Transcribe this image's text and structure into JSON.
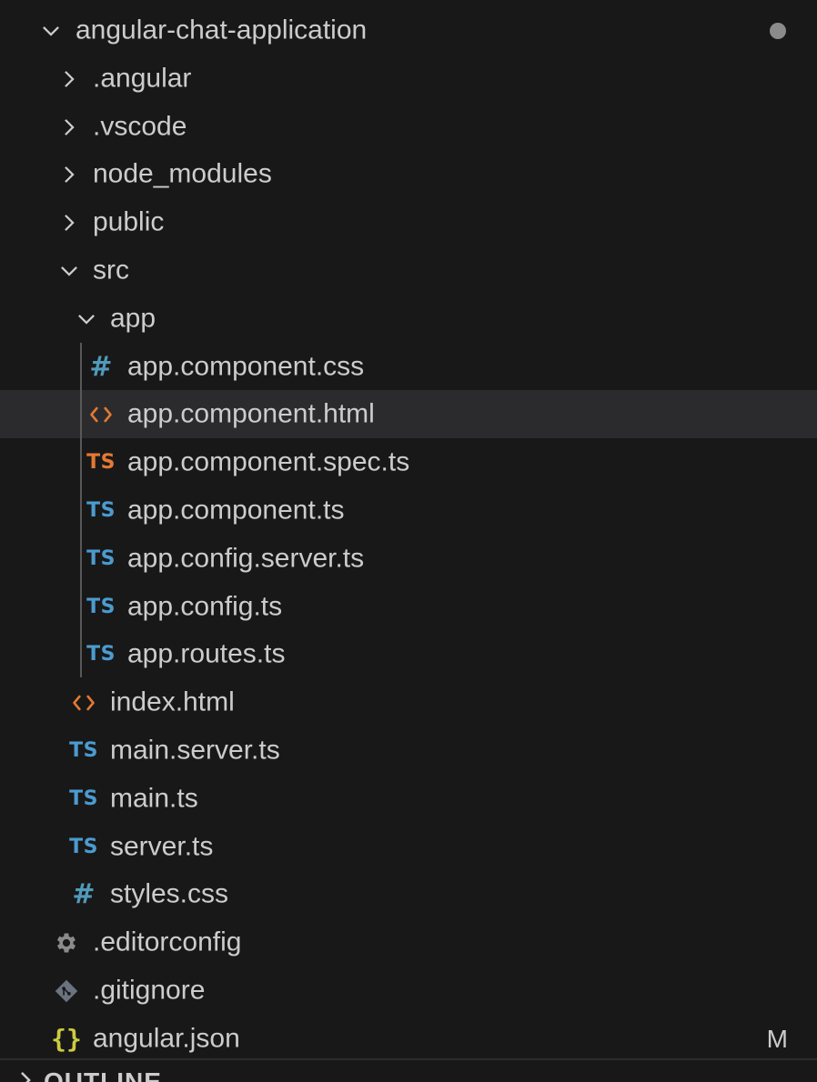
{
  "explorer": {
    "root": {
      "label": "angular-chat-application",
      "expanded": true,
      "status": "modified-dot"
    },
    "folders": [
      {
        "label": ".angular",
        "expanded": false
      },
      {
        "label": ".vscode",
        "expanded": false
      },
      {
        "label": "node_modules",
        "expanded": false
      },
      {
        "label": "public",
        "expanded": false
      }
    ],
    "src": {
      "label": "src",
      "expanded": true
    },
    "app": {
      "label": "app",
      "expanded": true
    },
    "app_files": [
      {
        "label": "app.component.css",
        "icon": "css-hash-icon",
        "icon_text": "#"
      },
      {
        "label": "app.component.html",
        "icon": "html-icon",
        "icon_text": "<>",
        "selected": true
      },
      {
        "label": "app.component.spec.ts",
        "icon": "ts-spec-icon",
        "icon_text": "TS"
      },
      {
        "label": "app.component.ts",
        "icon": "ts-icon",
        "icon_text": "TS"
      },
      {
        "label": "app.config.server.ts",
        "icon": "ts-icon",
        "icon_text": "TS"
      },
      {
        "label": "app.config.ts",
        "icon": "ts-icon",
        "icon_text": "TS"
      },
      {
        "label": "app.routes.ts",
        "icon": "ts-icon",
        "icon_text": "TS"
      }
    ],
    "src_files": [
      {
        "label": "index.html",
        "icon": "html-icon",
        "icon_text": "<>"
      },
      {
        "label": "main.server.ts",
        "icon": "ts-icon",
        "icon_text": "TS"
      },
      {
        "label": "main.ts",
        "icon": "ts-icon",
        "icon_text": "TS"
      },
      {
        "label": "server.ts",
        "icon": "ts-icon",
        "icon_text": "TS"
      },
      {
        "label": "styles.css",
        "icon": "css-hash-icon",
        "icon_text": "#"
      }
    ],
    "root_files": [
      {
        "label": ".editorconfig",
        "icon": "gear-icon"
      },
      {
        "label": ".gitignore",
        "icon": "git-icon"
      },
      {
        "label": "angular.json",
        "icon": "json-braces-icon",
        "icon_text": "{}",
        "badge": "M"
      }
    ]
  },
  "outline": {
    "label": "OUTLINE"
  },
  "colors": {
    "background": "#181818",
    "selected_row": "#2b2b2d",
    "text": "#cccccc",
    "ts_blue": "#4b9bd0",
    "ts_orange": "#e37933",
    "html_orange": "#e37933",
    "css_blue": "#519aba",
    "json_yellow": "#cbcb41",
    "icon_gray": "#8b8b8b"
  }
}
